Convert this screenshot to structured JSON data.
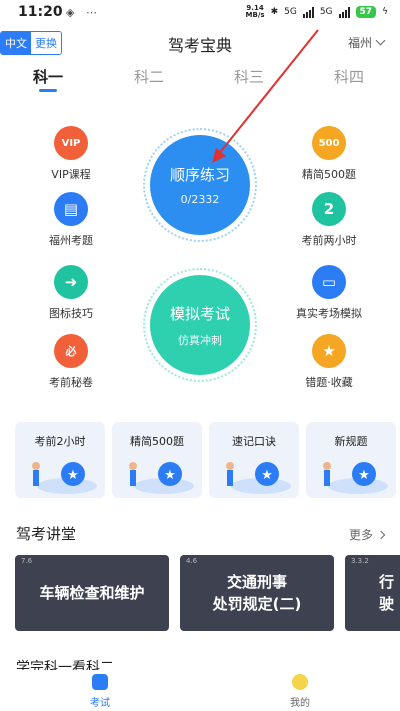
{
  "status_bar": {
    "time": "11:20",
    "net_speed_value": "9.14",
    "net_speed_unit": "MB/s",
    "network": "5G",
    "battery": "57"
  },
  "header": {
    "lang_active": "中文",
    "lang_switch": "更换",
    "title": "驾考宝典",
    "city": "福州"
  },
  "tabs": [
    "科一",
    "科二",
    "科三",
    "科四"
  ],
  "features_left": [
    {
      "label": "VIP课程",
      "icon": "vip-icon",
      "color": "#f2603a",
      "glyph": "VIP"
    },
    {
      "label": "福州考题",
      "icon": "document-pin-icon",
      "color": "#2b7cf5",
      "glyph": "▤"
    },
    {
      "label": "图标技巧",
      "icon": "arrow-right-icon",
      "color": "#1fc3a0",
      "glyph": "➜"
    },
    {
      "label": "考前秘卷",
      "icon": "secret-paper-icon",
      "color": "#f2603a",
      "glyph": "必"
    }
  ],
  "features_right": [
    {
      "label": "精简500题",
      "icon": "500-icon",
      "color": "#f5a623",
      "glyph": "500"
    },
    {
      "label": "考前两小时",
      "icon": "timer-icon",
      "color": "#1fc3a0",
      "glyph": "2"
    },
    {
      "label": "真实考场模拟",
      "icon": "monitor-icon",
      "color": "#2b7cf5",
      "glyph": "▭"
    },
    {
      "label": "错题·收藏",
      "icon": "star-icon",
      "color": "#f5a623",
      "glyph": "★"
    }
  ],
  "sequential": {
    "label": "顺序练习",
    "progress": "0/2332",
    "color": "#2b8ef0"
  },
  "mock_exam": {
    "label": "模拟考试",
    "sub": "仿真冲刺",
    "color": "#2fd0b0"
  },
  "quick_cards": [
    "考前2小时",
    "精简500题",
    "速记口诀",
    "新规题"
  ],
  "lecture": {
    "title": "驾考讲堂",
    "more": "更多",
    "videos": [
      {
        "tag": "7.6",
        "line1": "车辆检查和维护",
        "line2": ""
      },
      {
        "tag": "4.6",
        "line1": "交通刑事",
        "line2": "处罚规定(二)"
      },
      {
        "tag": "3.3.2",
        "line1": "行驶",
        "line2": ""
      }
    ]
  },
  "cut_section": "学完科一看科二",
  "bottom_nav": [
    {
      "label": "考试",
      "active": true
    },
    {
      "label": "我的",
      "active": false
    }
  ],
  "colors": {
    "accent": "#2b7cf5"
  }
}
